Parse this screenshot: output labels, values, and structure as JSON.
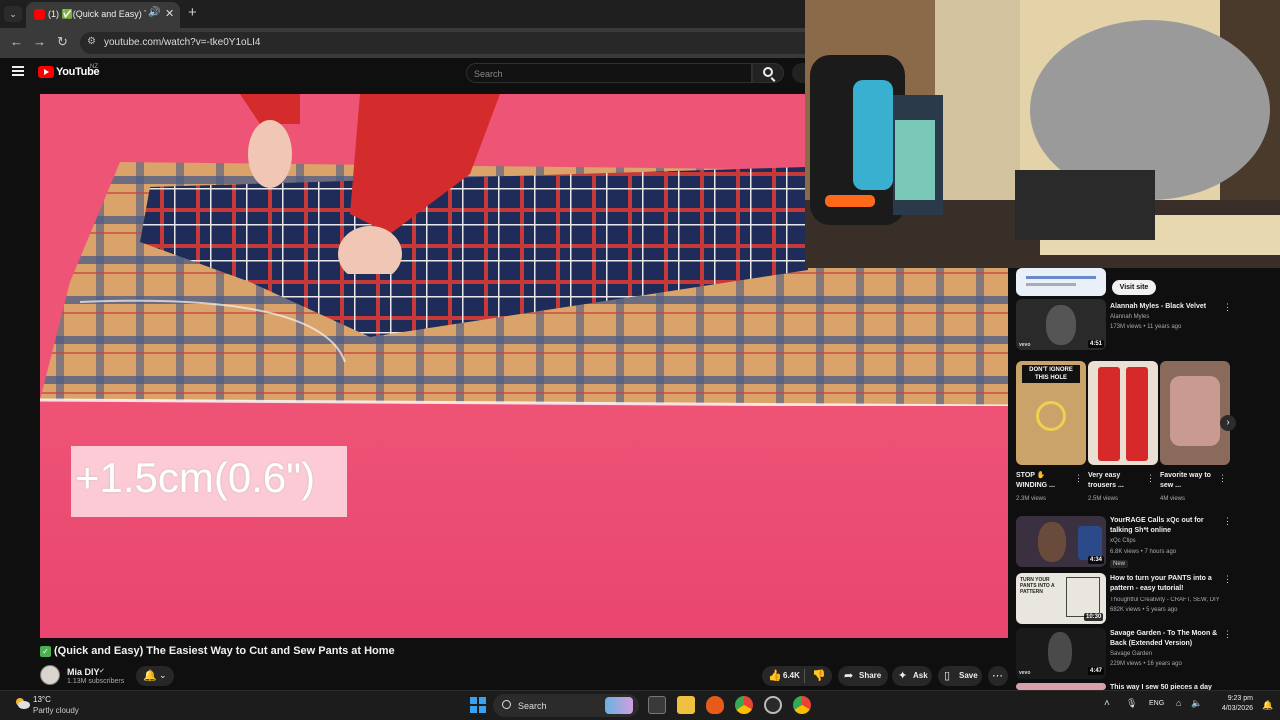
{
  "browser": {
    "tab_title": "(1) ✅(Quick and Easy) The",
    "url": "youtube.com/watch?v=-tke0Y1oLI4"
  },
  "youtube": {
    "wordmark": "YouTube",
    "country": "NZ",
    "search_placeholder": "Search"
  },
  "video": {
    "caption_overlay": "+1.5cm(0.6\")",
    "title": "(Quick and Easy) The Easiest Way to Cut and Sew Pants at Home",
    "channel_name": "Mia DIY",
    "channel_subs": "1.13M subscribers",
    "like_count": "6.4K",
    "share_label": "Share",
    "ask_label": "Ask",
    "save_label": "Save"
  },
  "sidebar": {
    "ad_visit_label": "Visit site",
    "rec1": {
      "title": "Alannah Myles - Black Velvet",
      "channel": "Alannah Myles",
      "meta": "173M views • 11 years ago",
      "duration": "4:51",
      "badge": "vevo"
    },
    "shorts": [
      {
        "thumb_text": "DON'T IGNORE THIS HOLE",
        "title": "STOP ✋ WINDING ...",
        "views": "2.3M views"
      },
      {
        "title": "Very easy trousers ...",
        "views": "2.5M views"
      },
      {
        "title": "Favorite way to sew ...",
        "views": "4M views"
      }
    ],
    "rec2": {
      "title": "YourRAGE Calls xQc out for talking Sh*t online",
      "channel": "xQc Clips",
      "meta": "6.8K views • 7 hours ago",
      "badge": "New",
      "duration": "4:34"
    },
    "rec3": {
      "title": "How to turn your PANTS into a pattern - easy tutorial!",
      "channel": "Thoughtful Creativity - CRAFT, SEW, DIY",
      "meta": "682K views • 5 years ago",
      "duration": "10:30",
      "thumb_text": "TURN YOUR PANTS INTO A PATTERN"
    },
    "rec4": {
      "title": "Savage Garden - To The Moon & Back (Extended Version)",
      "channel": "Savage Garden",
      "meta": "229M views • 16 years ago",
      "duration": "4:47",
      "badge": "vevo"
    },
    "rec5_partial": "This way I sew 50 pieces a day"
  },
  "taskbar": {
    "weather_temp": "13°C",
    "weather_desc": "Partly cloudy",
    "search_label": "Search",
    "lang": "ENG",
    "time": "9:23 pm",
    "date": "4/03/2026"
  },
  "colors": {
    "youtube_red": "#ff0000",
    "video_pink": "#ee5476",
    "background": "#0f0f0f"
  }
}
